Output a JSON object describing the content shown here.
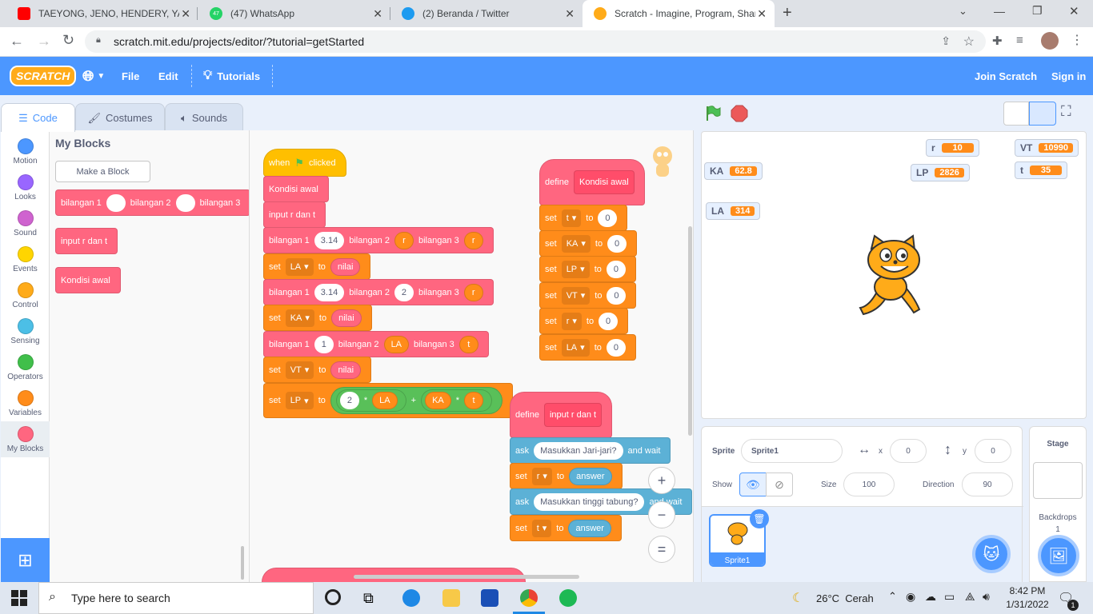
{
  "browser": {
    "tabs": [
      {
        "title": "TAEYONG, JENO, HENDERY, YANG"
      },
      {
        "title": "(47) WhatsApp"
      },
      {
        "title": "(2) Beranda / Twitter"
      },
      {
        "title": "Scratch - Imagine, Program, Shar"
      }
    ],
    "whatsapp_badge": "47",
    "url": "scratch.mit.edu/projects/editor/?tutorial=getStarted"
  },
  "menubar": {
    "logo": "SCRATCH",
    "file": "File",
    "edit": "Edit",
    "tutorials": "Tutorials",
    "join": "Join Scratch",
    "signin": "Sign in"
  },
  "editor_tabs": {
    "code": "Code",
    "costumes": "Costumes",
    "sounds": "Sounds"
  },
  "categories": [
    {
      "label": "Motion",
      "color": "#4c97ff"
    },
    {
      "label": "Looks",
      "color": "#9966ff"
    },
    {
      "label": "Sound",
      "color": "#cf63cf"
    },
    {
      "label": "Events",
      "color": "#ffd500"
    },
    {
      "label": "Control",
      "color": "#ffab19"
    },
    {
      "label": "Sensing",
      "color": "#4cbfe6"
    },
    {
      "label": "Operators",
      "color": "#40bf4a"
    },
    {
      "label": "Variables",
      "color": "#ff8c1a"
    },
    {
      "label": "My Blocks",
      "color": "#ff6680"
    }
  ],
  "palette": {
    "heading": "My Blocks",
    "make_block": "Make a Block",
    "block1": {
      "a": "bilangan 1",
      "b": "bilangan 2",
      "c": "bilangan 3"
    },
    "block2": "input r dan t",
    "block3": "Kondisi awal"
  },
  "script_main": {
    "when": "when",
    "clicked": "clicked",
    "kondisi": "Kondisi awal",
    "input": "input r dan t",
    "b1": "bilangan 1",
    "b2": "bilangan 2",
    "b3": "bilangan 3",
    "pi": "3.14",
    "r": "r",
    "two": "2",
    "one": "1",
    "t": "t",
    "set": "set",
    "to": "to",
    "nilai": "nilai",
    "LA": "LA",
    "KA": "KA",
    "VT": "VT",
    "LP": "LP",
    "times": "*",
    "plus": "+"
  },
  "script_define1": {
    "define": "define",
    "name": "Kondisi awal",
    "rows": [
      {
        "var": "t",
        "val": "0"
      },
      {
        "var": "KA",
        "val": "0"
      },
      {
        "var": "LP",
        "val": "0"
      },
      {
        "var": "VT",
        "val": "0"
      },
      {
        "var": "r",
        "val": "0"
      },
      {
        "var": "LA",
        "val": "0"
      }
    ]
  },
  "script_define2": {
    "define": "define",
    "name": "input r dan t",
    "ask": "ask",
    "and_wait": "and wait",
    "q1": "Masukkan Jari-jari?",
    "q2": "Masukkan tinggi tabung?",
    "answer": "answer",
    "r": "r",
    "t": "t"
  },
  "zoom": {
    "in": "+",
    "out": "−",
    "reset": "="
  },
  "stage_monitors": [
    {
      "name": "r",
      "value": "10"
    },
    {
      "name": "VT",
      "value": "10990"
    },
    {
      "name": "KA",
      "value": "62.8"
    },
    {
      "name": "LP",
      "value": "2826"
    },
    {
      "name": "t",
      "value": "35"
    },
    {
      "name": "LA",
      "value": "314"
    }
  ],
  "sprite_info": {
    "sprite_label": "Sprite",
    "sprite_name": "Sprite1",
    "x_label": "x",
    "x": "0",
    "y_label": "y",
    "y": "0",
    "show_label": "Show",
    "size_label": "Size",
    "size": "100",
    "direction_label": "Direction",
    "direction": "90",
    "thumb_name": "Sprite1"
  },
  "stage_pane": {
    "title": "Stage",
    "backdrops": "Backdrops",
    "count": "1"
  },
  "taskbar": {
    "search_placeholder": "Type here to search",
    "weather": "26°C  Cerah",
    "time": "8:42 PM",
    "date": "1/31/2022",
    "notif_count": "1"
  }
}
